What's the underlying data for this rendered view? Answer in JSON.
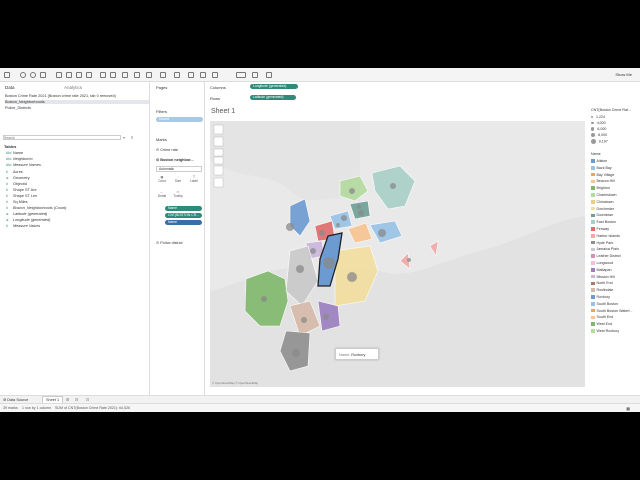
{
  "toolbar": {
    "show_me": "Show Me"
  },
  "data_pane": {
    "tab_data": "Data",
    "tab_analytics": "Analytics",
    "sources": [
      "Boston Crime Rate 2021 (Boston crime rate 2021, tab 0 removed)",
      "Boston_Neighborhoods",
      "Police_Districts"
    ],
    "search_placeholder": "Search",
    "tables_heading": "Tables",
    "fields": [
      {
        "icon": "Abc",
        "name": "Name"
      },
      {
        "icon": "Abc",
        "name": "Neighborho"
      },
      {
        "icon": "Abc",
        "name": "Measure Names"
      },
      {
        "icon": "#",
        "name": "Acres"
      },
      {
        "icon": "⊕",
        "name": "Geometry"
      },
      {
        "icon": "#",
        "name": "Objectid"
      },
      {
        "icon": "#",
        "name": "Shape ST Are"
      },
      {
        "icon": "#",
        "name": "Shape ST Len"
      },
      {
        "icon": "#",
        "name": "Sq Miles"
      },
      {
        "icon": "#",
        "name": "Boston_Neighborhoods (Count)"
      },
      {
        "icon": "⊕",
        "name": "Latitude (generated)"
      },
      {
        "icon": "⊕",
        "name": "Longitude (generated)"
      },
      {
        "icon": "#",
        "name": "Measure Values"
      }
    ]
  },
  "cards": {
    "pages": "Pages",
    "filters": "Filters",
    "filter_pill": "District",
    "marks": "Marks",
    "mark_layers": [
      "Crime rate",
      "Boston neighbor..."
    ],
    "mark_type": "Automatic",
    "buttons": [
      "Color",
      "Size",
      "Label",
      "Detail",
      "Tooltip"
    ],
    "mark_pills": [
      "Name",
      "CNT(BOSTON CR...",
      "Name"
    ],
    "police_layer": "Police district"
  },
  "shelves": {
    "columns_label": "Columns",
    "columns_pill": "Longitude (generated)",
    "rows_label": "Rows",
    "rows_pill": "Latitude (generated)"
  },
  "sheet": {
    "title": "Sheet 1",
    "attribution": "© OpenStreetMap © OpenStreetMap",
    "tooltip_key": "Name:",
    "tooltip_value": "Roxbury"
  },
  "legend": {
    "size_title": "CNT(Boston Crime Rat...",
    "size_values": [
      "1,224",
      "4,000",
      "6,000",
      "8,000",
      "9,197"
    ],
    "name_title": "Name",
    "names": [
      {
        "name": "Allston",
        "color": "#6c9bd2"
      },
      {
        "name": "Back Bay",
        "color": "#98c3e6"
      },
      {
        "name": "Bay Village",
        "color": "#f3a25a"
      },
      {
        "name": "Beacon Hill",
        "color": "#f7c491"
      },
      {
        "name": "Brighton",
        "color": "#7fb86c"
      },
      {
        "name": "Charlestown",
        "color": "#b4dba0"
      },
      {
        "name": "Chinatown",
        "color": "#e8d17a"
      },
      {
        "name": "Dorchester",
        "color": "#f2de9e"
      },
      {
        "name": "Downtown",
        "color": "#6f9f96"
      },
      {
        "name": "East Boston",
        "color": "#a8cfc7"
      },
      {
        "name": "Fenway",
        "color": "#e26b6b"
      },
      {
        "name": "Harbor Islands",
        "color": "#f4a7a7"
      },
      {
        "name": "Hyde Park",
        "color": "#8f8f8f"
      },
      {
        "name": "Jamaica Plain",
        "color": "#c9c9c9"
      },
      {
        "name": "Leather District",
        "color": "#d68fb9"
      },
      {
        "name": "Longwood",
        "color": "#f0bfdc"
      },
      {
        "name": "Mattapan",
        "color": "#9c7fbf"
      },
      {
        "name": "Mission Hill",
        "color": "#c9b7dc"
      },
      {
        "name": "North End",
        "color": "#a67c66"
      },
      {
        "name": "Roslindale",
        "color": "#d5b9a8"
      },
      {
        "name": "Roxbury",
        "color": "#6c9bd2"
      },
      {
        "name": "South Boston",
        "color": "#98c3e6"
      },
      {
        "name": "South Boston Waterf...",
        "color": "#f3a25a"
      },
      {
        "name": "South End",
        "color": "#f7c491"
      },
      {
        "name": "West End",
        "color": "#7fb86c"
      },
      {
        "name": "West Roxbury",
        "color": "#b4dba0"
      }
    ]
  },
  "bottom": {
    "data_source_tab": "Data Source",
    "sheet_tab": "Sheet 1",
    "status_marks": "39 marks",
    "status_rows": "1 row by 1 column",
    "status_sum": "SUM of CNT(Boston Crime Rate 2021): 64,526"
  }
}
